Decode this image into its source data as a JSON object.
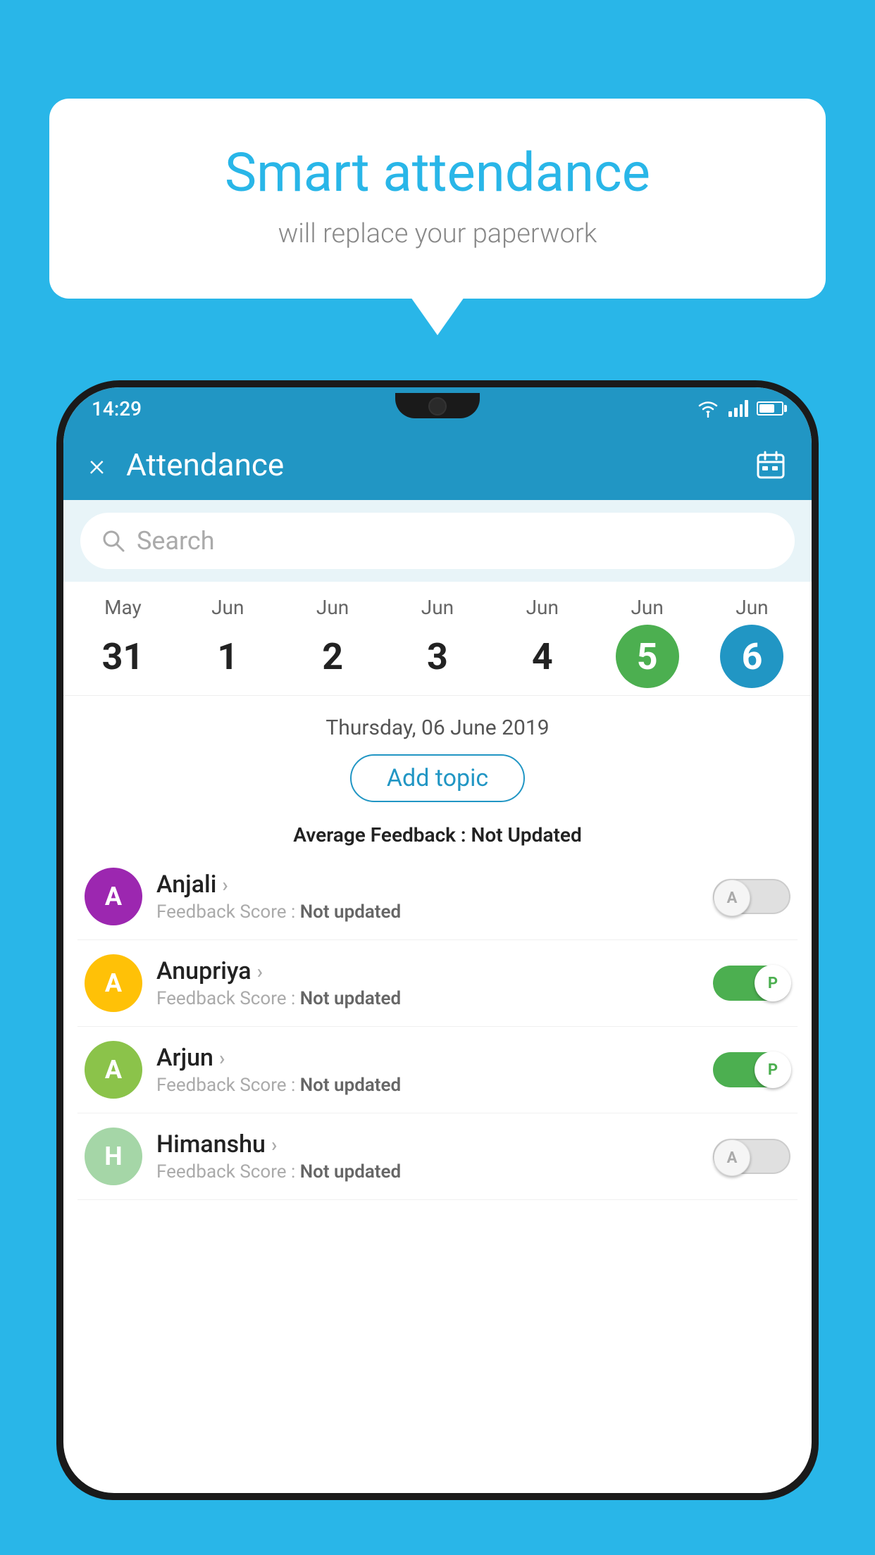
{
  "background_color": "#29b6e8",
  "bubble": {
    "title": "Smart attendance",
    "subtitle": "will replace your paperwork"
  },
  "status_bar": {
    "time": "14:29",
    "wifi_icon": "wifi-icon",
    "signal_icon": "signal-icon",
    "battery_icon": "battery-icon"
  },
  "header": {
    "title": "Attendance",
    "close_label": "×",
    "calendar_icon": "calendar-icon"
  },
  "search": {
    "placeholder": "Search"
  },
  "calendar": {
    "days": [
      {
        "month": "May",
        "date": "31",
        "state": "normal"
      },
      {
        "month": "Jun",
        "date": "1",
        "state": "normal"
      },
      {
        "month": "Jun",
        "date": "2",
        "state": "normal"
      },
      {
        "month": "Jun",
        "date": "3",
        "state": "normal"
      },
      {
        "month": "Jun",
        "date": "4",
        "state": "normal"
      },
      {
        "month": "Jun",
        "date": "5",
        "state": "today"
      },
      {
        "month": "Jun",
        "date": "6",
        "state": "selected"
      }
    ]
  },
  "selected_date": {
    "display": "Thursday, 06 June 2019",
    "add_topic_label": "Add topic",
    "avg_feedback_label": "Average Feedback : ",
    "avg_feedback_value": "Not Updated"
  },
  "students": [
    {
      "name": "Anjali",
      "avatar_letter": "A",
      "avatar_color": "#9c27b0",
      "feedback_label": "Feedback Score : ",
      "feedback_value": "Not updated",
      "toggle_state": "off",
      "toggle_label": "A"
    },
    {
      "name": "Anupriya",
      "avatar_letter": "A",
      "avatar_color": "#ffc107",
      "feedback_label": "Feedback Score : ",
      "feedback_value": "Not updated",
      "toggle_state": "on",
      "toggle_label": "P"
    },
    {
      "name": "Arjun",
      "avatar_letter": "A",
      "avatar_color": "#8bc34a",
      "feedback_label": "Feedback Score : ",
      "feedback_value": "Not updated",
      "toggle_state": "on",
      "toggle_label": "P"
    },
    {
      "name": "Himanshu",
      "avatar_letter": "H",
      "avatar_color": "#a5d6a7",
      "feedback_label": "Feedback Score : ",
      "feedback_value": "Not updated",
      "toggle_state": "off",
      "toggle_label": "A"
    }
  ]
}
